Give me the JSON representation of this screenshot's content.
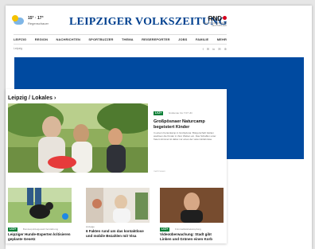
{
  "header": {
    "weather_temp": "15° · 17°",
    "weather_desc": "Regenschauer",
    "logo": "LEIPZIGER VOLKSZEITUNG",
    "rnd_label": "RND",
    "rnd_sub": "REDAKTIONSNETZWERK DEUTSCHLAND"
  },
  "nav": {
    "items": [
      {
        "label": "LEIPZIG"
      },
      {
        "label": "REGION"
      },
      {
        "label": "NACHRICHTEN"
      },
      {
        "label": "SPORTBUZZER"
      },
      {
        "label": "THEMA"
      },
      {
        "label": "REISEREPORTER"
      },
      {
        "label": "JOBS"
      },
      {
        "label": "FAMILIE"
      },
      {
        "label": "MEHR"
      }
    ]
  },
  "subbar": {
    "home": "Leipzig",
    "social": [
      "f",
      "✉",
      "in",
      "✉",
      "⊕"
    ]
  },
  "section": {
    "title": "Leipzig / Lokales ›"
  },
  "hero": {
    "badge": "LVZ+",
    "meta": "Grabenau bis 7:07 Uhr",
    "headline": "Großpösnaer Naturcamp begeistert Kinder",
    "teaser": "In einem Ferienkamp in Großpösna: Bürgerschaft Gärten wachsen die Kinder in ihrer Welten ein. Das Schaffen unter freiem Himmel ist dabei nur eines der vielen Erlebnisse.",
    "more": "mehr lesen"
  },
  "cards": [
    {
      "badge": "LVZ+",
      "topic": "Bundespolizeigewalt Verstärkung",
      "title": "Leipziger Hunde-Experten kritisieren geplante Gesetz"
    },
    {
      "badge": "",
      "topic": "Anzeige",
      "title": "6 Fakten rund um das kontaktlose und mobile Bezahlen mit Visa"
    },
    {
      "badge": "LVZ+",
      "topic": "Kriminalitätsbekämpfung",
      "title": "Videoüberwachung: Stadt gibt Linken und Grünen einen Korb"
    }
  ],
  "colors": {
    "brand_blue": "#00408f",
    "banner_blue": "#004aa0",
    "badge_green": "#0b7f37",
    "rnd_red": "#d6001c"
  }
}
